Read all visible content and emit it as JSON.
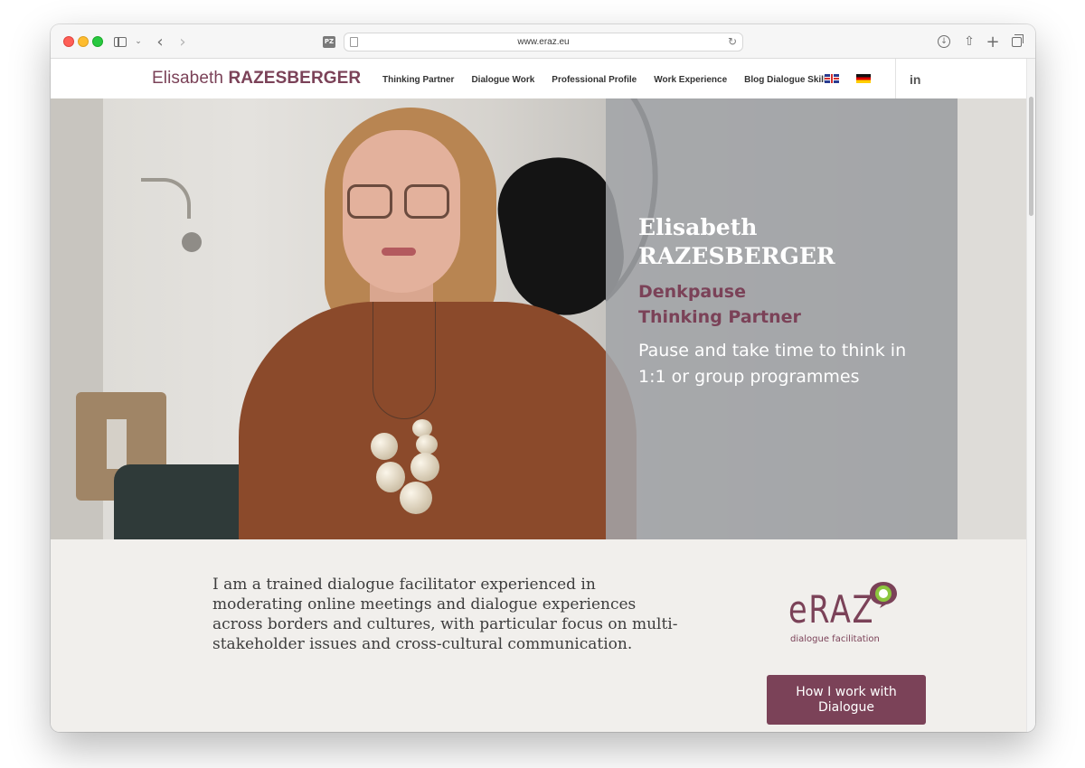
{
  "browser": {
    "url": "www.eraz.eu",
    "icons": [
      "sidebar-icon",
      "chevron-down-icon",
      "back-icon",
      "forward-icon",
      "reader-icon",
      "page-icon",
      "reload-icon",
      "download-icon",
      "share-icon",
      "new-tab-icon",
      "tabs-icon"
    ]
  },
  "site": {
    "logo_first": "Elisabeth",
    "logo_last": "RAZESBERGER",
    "nav": [
      "Thinking Partner",
      "Dialogue Work",
      "Professional Profile",
      "Work Experience",
      "Blog Dialogue Skills"
    ],
    "linkedin": "in",
    "brand_color": "#7b4258"
  },
  "hero": {
    "name_line1": "Elisabeth",
    "name_line2": "RAZESBERGER",
    "sub_line1": "Denkpause",
    "sub_line2": "Thinking Partner",
    "tagline": "Pause and take time to think in 1:1 or group programmes"
  },
  "intro": {
    "text": "I am a trained dialogue facilitator experienced in moderating online meetings and dialogue experiences across borders and cultures, with particular focus on multi-stakeholder issues and cross-cultural communication."
  },
  "eraz": {
    "word": "eRAZ",
    "caption": "dialogue facilitation"
  },
  "cta": {
    "label": "How I work with Dialogue"
  }
}
